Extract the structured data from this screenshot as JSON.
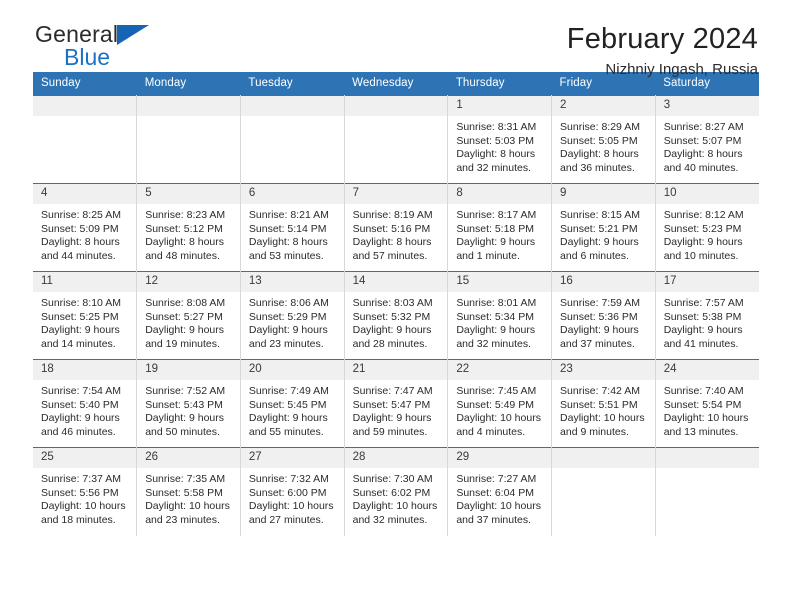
{
  "brand": {
    "name_top": "General",
    "name_bottom": "Blue",
    "triangle_color": "#1565b4",
    "text_color": "#2b2b2b",
    "blue_color": "#1a72c4"
  },
  "header": {
    "title": "February 2024",
    "subtitle": "Nizhniy Ingash, Russia"
  },
  "theme": {
    "header_bar": "#2e74b5",
    "daynum_band": "#f0f0f0",
    "cell_divider": "#d8d8d8",
    "text": "#2b2b2b"
  },
  "calendar": {
    "weekday_headers": [
      "Sunday",
      "Monday",
      "Tuesday",
      "Wednesday",
      "Thursday",
      "Friday",
      "Saturday"
    ],
    "weeks": [
      [
        {
          "empty": true
        },
        {
          "empty": true
        },
        {
          "empty": true
        },
        {
          "empty": true
        },
        {
          "day": "1",
          "sunrise": "Sunrise: 8:31 AM",
          "sunset": "Sunset: 5:03 PM",
          "daylight1": "Daylight: 8 hours",
          "daylight2": "and 32 minutes."
        },
        {
          "day": "2",
          "sunrise": "Sunrise: 8:29 AM",
          "sunset": "Sunset: 5:05 PM",
          "daylight1": "Daylight: 8 hours",
          "daylight2": "and 36 minutes."
        },
        {
          "day": "3",
          "sunrise": "Sunrise: 8:27 AM",
          "sunset": "Sunset: 5:07 PM",
          "daylight1": "Daylight: 8 hours",
          "daylight2": "and 40 minutes."
        }
      ],
      [
        {
          "day": "4",
          "sunrise": "Sunrise: 8:25 AM",
          "sunset": "Sunset: 5:09 PM",
          "daylight1": "Daylight: 8 hours",
          "daylight2": "and 44 minutes."
        },
        {
          "day": "5",
          "sunrise": "Sunrise: 8:23 AM",
          "sunset": "Sunset: 5:12 PM",
          "daylight1": "Daylight: 8 hours",
          "daylight2": "and 48 minutes."
        },
        {
          "day": "6",
          "sunrise": "Sunrise: 8:21 AM",
          "sunset": "Sunset: 5:14 PM",
          "daylight1": "Daylight: 8 hours",
          "daylight2": "and 53 minutes."
        },
        {
          "day": "7",
          "sunrise": "Sunrise: 8:19 AM",
          "sunset": "Sunset: 5:16 PM",
          "daylight1": "Daylight: 8 hours",
          "daylight2": "and 57 minutes."
        },
        {
          "day": "8",
          "sunrise": "Sunrise: 8:17 AM",
          "sunset": "Sunset: 5:18 PM",
          "daylight1": "Daylight: 9 hours",
          "daylight2": "and 1 minute."
        },
        {
          "day": "9",
          "sunrise": "Sunrise: 8:15 AM",
          "sunset": "Sunset: 5:21 PM",
          "daylight1": "Daylight: 9 hours",
          "daylight2": "and 6 minutes."
        },
        {
          "day": "10",
          "sunrise": "Sunrise: 8:12 AM",
          "sunset": "Sunset: 5:23 PM",
          "daylight1": "Daylight: 9 hours",
          "daylight2": "and 10 minutes."
        }
      ],
      [
        {
          "day": "11",
          "sunrise": "Sunrise: 8:10 AM",
          "sunset": "Sunset: 5:25 PM",
          "daylight1": "Daylight: 9 hours",
          "daylight2": "and 14 minutes."
        },
        {
          "day": "12",
          "sunrise": "Sunrise: 8:08 AM",
          "sunset": "Sunset: 5:27 PM",
          "daylight1": "Daylight: 9 hours",
          "daylight2": "and 19 minutes."
        },
        {
          "day": "13",
          "sunrise": "Sunrise: 8:06 AM",
          "sunset": "Sunset: 5:29 PM",
          "daylight1": "Daylight: 9 hours",
          "daylight2": "and 23 minutes."
        },
        {
          "day": "14",
          "sunrise": "Sunrise: 8:03 AM",
          "sunset": "Sunset: 5:32 PM",
          "daylight1": "Daylight: 9 hours",
          "daylight2": "and 28 minutes."
        },
        {
          "day": "15",
          "sunrise": "Sunrise: 8:01 AM",
          "sunset": "Sunset: 5:34 PM",
          "daylight1": "Daylight: 9 hours",
          "daylight2": "and 32 minutes."
        },
        {
          "day": "16",
          "sunrise": "Sunrise: 7:59 AM",
          "sunset": "Sunset: 5:36 PM",
          "daylight1": "Daylight: 9 hours",
          "daylight2": "and 37 minutes."
        },
        {
          "day": "17",
          "sunrise": "Sunrise: 7:57 AM",
          "sunset": "Sunset: 5:38 PM",
          "daylight1": "Daylight: 9 hours",
          "daylight2": "and 41 minutes."
        }
      ],
      [
        {
          "day": "18",
          "sunrise": "Sunrise: 7:54 AM",
          "sunset": "Sunset: 5:40 PM",
          "daylight1": "Daylight: 9 hours",
          "daylight2": "and 46 minutes."
        },
        {
          "day": "19",
          "sunrise": "Sunrise: 7:52 AM",
          "sunset": "Sunset: 5:43 PM",
          "daylight1": "Daylight: 9 hours",
          "daylight2": "and 50 minutes."
        },
        {
          "day": "20",
          "sunrise": "Sunrise: 7:49 AM",
          "sunset": "Sunset: 5:45 PM",
          "daylight1": "Daylight: 9 hours",
          "daylight2": "and 55 minutes."
        },
        {
          "day": "21",
          "sunrise": "Sunrise: 7:47 AM",
          "sunset": "Sunset: 5:47 PM",
          "daylight1": "Daylight: 9 hours",
          "daylight2": "and 59 minutes."
        },
        {
          "day": "22",
          "sunrise": "Sunrise: 7:45 AM",
          "sunset": "Sunset: 5:49 PM",
          "daylight1": "Daylight: 10 hours",
          "daylight2": "and 4 minutes."
        },
        {
          "day": "23",
          "sunrise": "Sunrise: 7:42 AM",
          "sunset": "Sunset: 5:51 PM",
          "daylight1": "Daylight: 10 hours",
          "daylight2": "and 9 minutes."
        },
        {
          "day": "24",
          "sunrise": "Sunrise: 7:40 AM",
          "sunset": "Sunset: 5:54 PM",
          "daylight1": "Daylight: 10 hours",
          "daylight2": "and 13 minutes."
        }
      ],
      [
        {
          "day": "25",
          "sunrise": "Sunrise: 7:37 AM",
          "sunset": "Sunset: 5:56 PM",
          "daylight1": "Daylight: 10 hours",
          "daylight2": "and 18 minutes."
        },
        {
          "day": "26",
          "sunrise": "Sunrise: 7:35 AM",
          "sunset": "Sunset: 5:58 PM",
          "daylight1": "Daylight: 10 hours",
          "daylight2": "and 23 minutes."
        },
        {
          "day": "27",
          "sunrise": "Sunrise: 7:32 AM",
          "sunset": "Sunset: 6:00 PM",
          "daylight1": "Daylight: 10 hours",
          "daylight2": "and 27 minutes."
        },
        {
          "day": "28",
          "sunrise": "Sunrise: 7:30 AM",
          "sunset": "Sunset: 6:02 PM",
          "daylight1": "Daylight: 10 hours",
          "daylight2": "and 32 minutes."
        },
        {
          "day": "29",
          "sunrise": "Sunrise: 7:27 AM",
          "sunset": "Sunset: 6:04 PM",
          "daylight1": "Daylight: 10 hours",
          "daylight2": "and 37 minutes."
        },
        {
          "empty": true
        },
        {
          "empty": true
        }
      ]
    ]
  }
}
